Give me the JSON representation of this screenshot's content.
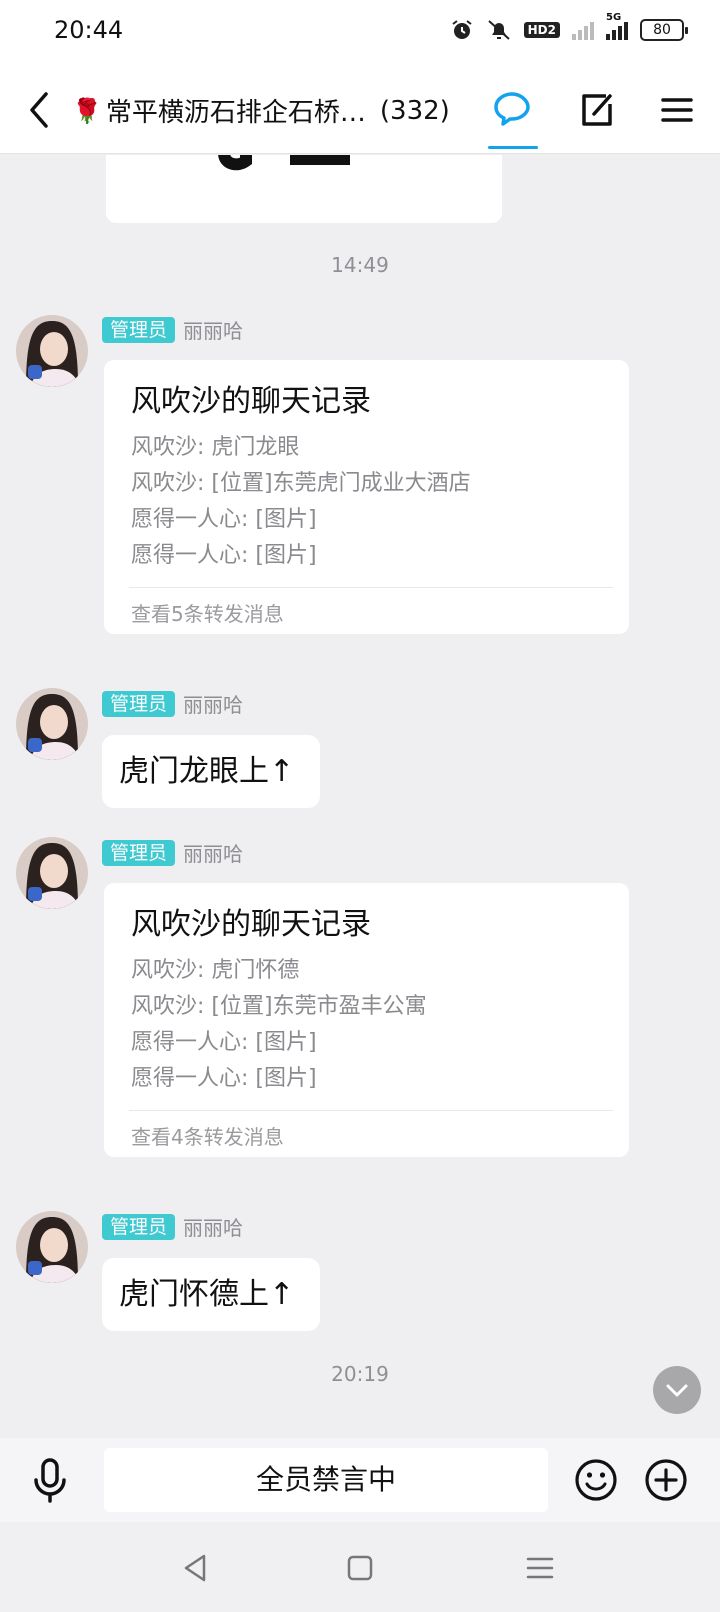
{
  "status_bar": {
    "time": "20:44",
    "hd_label": "HD2",
    "network_label": "5G",
    "battery": "80"
  },
  "header": {
    "back_icon": "chevron-left-icon",
    "title_emoji": "🌹",
    "title": "常平横沥石排企石桥…",
    "member_count": "(332)",
    "active_tab_icon": "chat-bubble-icon",
    "accent_color": "#12a3ee"
  },
  "messages": {
    "timestamp_1": "14:49",
    "msg1": {
      "badge": "管理员",
      "sender": "丽丽哈",
      "title": "风吹沙的聊天记录",
      "lines": [
        "风吹沙: 虎门龙眼",
        "风吹沙: [位置]东莞虎门成业大酒店",
        "愿得一人心: [图片]",
        "愿得一人心: [图片]"
      ],
      "footer": "查看5条转发消息"
    },
    "msg2": {
      "badge": "管理员",
      "sender": "丽丽哈",
      "text": "虎门龙眼上↑"
    },
    "msg3": {
      "badge": "管理员",
      "sender": "丽丽哈",
      "title": "风吹沙的聊天记录",
      "lines": [
        "风吹沙: 虎门怀德",
        "风吹沙: [位置]东莞市盈丰公寓",
        "愿得一人心: [图片]",
        "愿得一人心: [图片]"
      ],
      "footer": "查看4条转发消息"
    },
    "msg4": {
      "badge": "管理员",
      "sender": "丽丽哈",
      "text": "虎门怀德上↑"
    },
    "timestamp_2": "20:19"
  },
  "input_bar": {
    "muted_text": "全员禁言中"
  },
  "colors": {
    "admin_badge": "#3fc9d1",
    "background": "#efeff1"
  }
}
